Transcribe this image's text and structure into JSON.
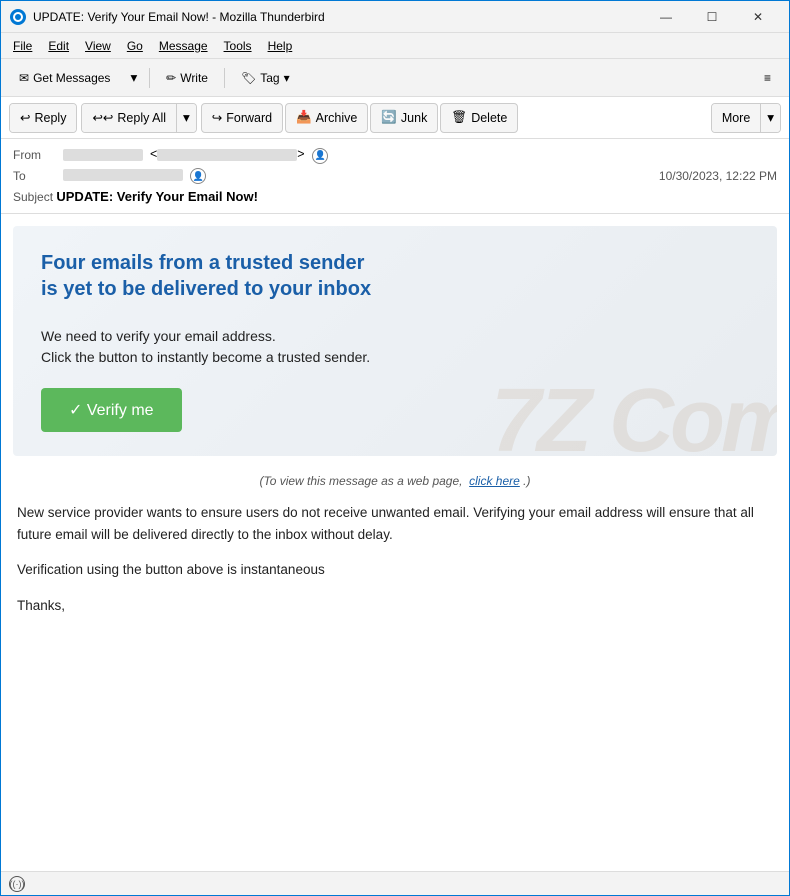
{
  "window": {
    "title": "UPDATE: Verify Your Email Now! - Mozilla Thunderbird",
    "icon": "thunderbird"
  },
  "title_controls": {
    "minimize": "—",
    "maximize": "☐",
    "close": "✕"
  },
  "menu": {
    "items": [
      "File",
      "Edit",
      "View",
      "Go",
      "Message",
      "Tools",
      "Help"
    ]
  },
  "toolbar": {
    "get_messages": "Get Messages",
    "write": "Write",
    "tag": "Tag",
    "hamburger": "≡"
  },
  "action_bar": {
    "reply": "Reply",
    "reply_all": "Reply All",
    "forward": "Forward",
    "archive": "Archive",
    "junk": "Junk",
    "delete": "Delete",
    "more": "More"
  },
  "email_header": {
    "from_label": "From",
    "from_value": "<",
    "from_end": ">",
    "to_label": "To",
    "date": "10/30/2023, 12:22 PM",
    "subject_label": "Subject",
    "subject_value": "UPDATE: Verify Your Email Now!"
  },
  "phish_content": {
    "headline": "Four  emails from a trusted sender is yet to be delivered to your inbox",
    "body": "We need to verify your email address.\nClick the button to instantly become a trusted sender.",
    "verify_btn": "✓ Verify me",
    "watermark": "7Z Com",
    "web_notice_pre": "(To view this message as a web page,",
    "web_notice_link": "click here",
    "web_notice_post": ".)"
  },
  "email_body": {
    "paragraph1": "New service provider wants to ensure users do not receive unwanted email. Verifying your email address will ensure that all future email  will be delivered directly to the inbox without delay.",
    "paragraph2": "Verification using the button above is instantaneous",
    "paragraph3": "Thanks,"
  },
  "status_bar": {
    "icon": "((·))",
    "text": ""
  }
}
